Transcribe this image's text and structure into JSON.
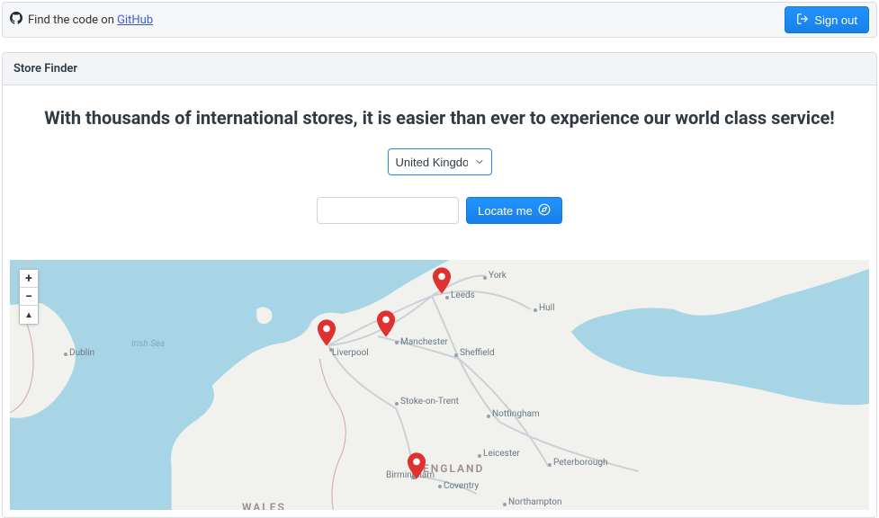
{
  "topbar": {
    "prefix_text": "Find the code on ",
    "link_text": "GitHub",
    "signout_label": "Sign out"
  },
  "panel": {
    "title": "Store Finder",
    "hero": "With thousands of international stores, it is easier than ever to experience our world class service!"
  },
  "country_select": {
    "selected": "United Kingdom",
    "options": [
      "United Kingdom"
    ]
  },
  "locate": {
    "input_value": "",
    "input_placeholder": "",
    "button_label": "Locate me"
  },
  "map": {
    "zoom_in": "+",
    "zoom_out": "−",
    "reset": "▴",
    "sea_label": "Irish Sea",
    "region_wales": "WALES",
    "region_england": "ENGLAND",
    "cities": {
      "york": "York",
      "leeds": "Leeds",
      "hull": "Hull",
      "manchester": "Manchester",
      "liverpool": "Liverpool",
      "sheffield": "Sheffield",
      "stoke": "Stoke-on-Trent",
      "nottingham": "Nottingham",
      "leicester": "Leicester",
      "peterborough": "Peterborough",
      "birmingham": "Birmingham",
      "coventry": "Coventry",
      "northampton": "Northampton",
      "dublin": "Dublin"
    },
    "pins": [
      {
        "name": "Leeds"
      },
      {
        "name": "Manchester"
      },
      {
        "name": "Liverpool"
      },
      {
        "name": "Birmingham"
      }
    ]
  },
  "colors": {
    "accent": "#1a7fe9",
    "pin": "#e03131",
    "sea": "#a8d5e5",
    "land": "#f1f2ee"
  }
}
